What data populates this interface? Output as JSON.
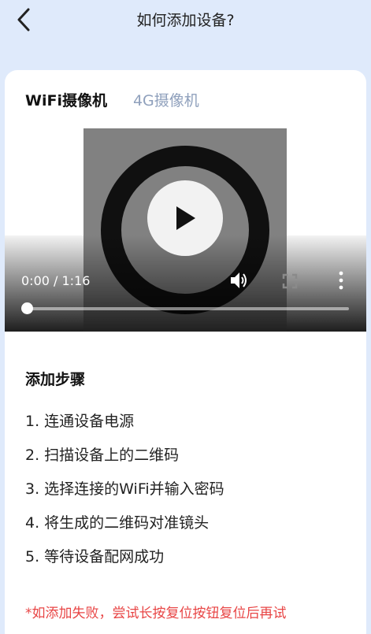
{
  "header": {
    "title": "如何添加设备?"
  },
  "tabs": [
    {
      "label": "WiFi摄像机",
      "active": true
    },
    {
      "label": "4G摄像机",
      "active": false
    }
  ],
  "video": {
    "time": "0:00 / 1:16",
    "progress": 0
  },
  "steps": {
    "title": "添加步骤",
    "items": [
      "1. 连通设备电源",
      "2. 扫描设备上的二维码",
      "3. 选择连接的WiFi并输入密码",
      "4. 将生成的二维码对准镜头",
      "5. 等待设备配网成功"
    ]
  },
  "warning": "*如添加失败，尝试长按复位按钮复位后再试",
  "colors": {
    "background": "#dfeafb",
    "inactive_tab": "#8fa0bc",
    "warning": "#e84545"
  },
  "icons": [
    "back-arrow-icon",
    "play-icon",
    "volume-icon",
    "fullscreen-icon",
    "more-vertical-icon"
  ]
}
